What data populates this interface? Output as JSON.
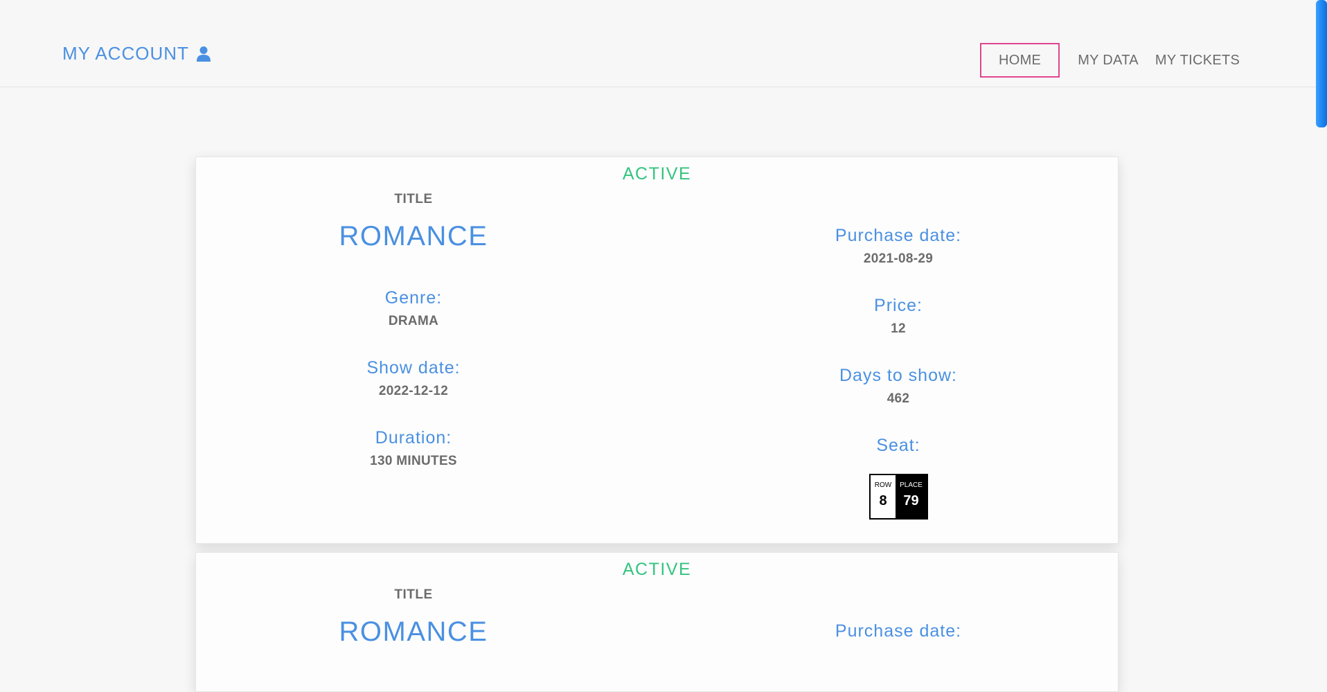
{
  "header": {
    "brand": "MY ACCOUNT",
    "nav": [
      "HOME",
      "MY DATA",
      "MY TICKETS"
    ]
  },
  "tickets": [
    {
      "status": "ACTIVE",
      "title_label": "TITLE",
      "title": "ROMANCE",
      "genre_label": "Genre:",
      "genre": "DRAMA",
      "show_date_label": "Show date:",
      "show_date": "2022-12-12",
      "duration_label": "Duration:",
      "duration": "130 MINUTES",
      "purchase_date_label": "Purchase date:",
      "purchase_date": "2021-08-29",
      "price_label": "Price:",
      "price": "12",
      "days_label": "Days to show:",
      "days": "462",
      "seat_label": "Seat:",
      "seat": {
        "row_label": "ROW",
        "row": "8",
        "place_label": "PLACE",
        "place": "79"
      }
    },
    {
      "status": "ACTIVE",
      "title_label": "TITLE",
      "title": "ROMANCE",
      "purchase_date_label": "Purchase date:"
    }
  ],
  "colors": {
    "accent": "#4a90e2",
    "active": "#33c47e",
    "nav_highlight": "#e0458f"
  }
}
